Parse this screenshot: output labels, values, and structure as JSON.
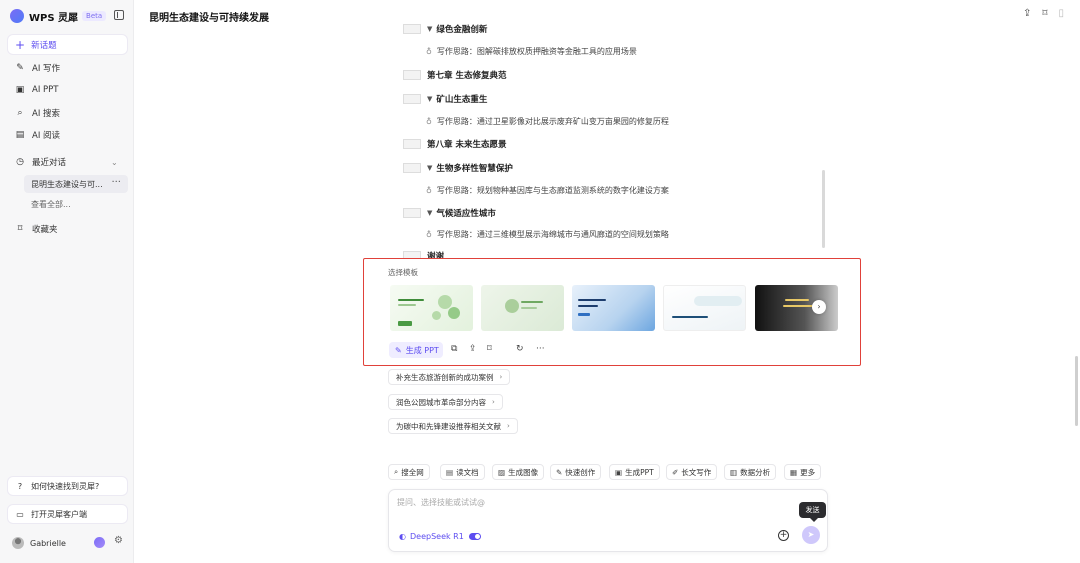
{
  "sidebar": {
    "brand": "WPS 灵犀",
    "beta": "Beta",
    "new_topic": "新话题",
    "nav": [
      {
        "icon": "✎",
        "label": "AI 写作"
      },
      {
        "icon": "▣",
        "label": "AI PPT"
      },
      {
        "icon": "⌕",
        "label": "AI 搜索"
      },
      {
        "icon": "▤",
        "label": "AI 阅读"
      }
    ],
    "recent_label": "最近对话",
    "recent_item": "昆明生态建设与可...",
    "see_all": "查看全部...",
    "favorites": "收藏夹",
    "help": "如何快速找到灵犀?",
    "open_client": "打开灵犀客户端",
    "user_name": "Gabrielle"
  },
  "header": {
    "title": "昆明生态建设与可持续发展"
  },
  "outline": [
    {
      "type": "section",
      "text": "绿色金融创新"
    },
    {
      "type": "idea",
      "text": "写作思路：图解碳排放权质押融资等金融工具的应用场景"
    },
    {
      "type": "chapter",
      "text": "第七章 生态修复典范"
    },
    {
      "type": "section",
      "text": "矿山生态重生"
    },
    {
      "type": "idea",
      "text": "写作思路：通过卫星影像对比展示废弃矿山变万亩果园的修复历程"
    },
    {
      "type": "chapter",
      "text": "第八章 未来生态愿景"
    },
    {
      "type": "section",
      "text": "生物多样性智慧保护"
    },
    {
      "type": "idea",
      "text": "写作思路：规划物种基因库与生态廊道监测系统的数字化建设方案"
    },
    {
      "type": "section",
      "text": "气候适应性城市"
    },
    {
      "type": "idea",
      "text": "写作思路：通过三维模型展示海绵城市与通风廊道的空间规划策略"
    },
    {
      "type": "chapter",
      "text": "谢谢"
    }
  ],
  "templates": {
    "label": "选择模板",
    "generate_ppt": "生成 PPT"
  },
  "suggestions": [
    "补充生态旅游创新的成功案例",
    "润色公园城市革命部分内容",
    "为碳中和先锋建设推荐相关文献"
  ],
  "tools": [
    {
      "icon": "⌕",
      "label": "搜全网"
    },
    {
      "icon": "▤",
      "label": "读文档"
    },
    {
      "icon": "▨",
      "label": "生成图像"
    },
    {
      "icon": "✎",
      "label": "快速创作"
    },
    {
      "icon": "▣",
      "label": "生成PPT"
    },
    {
      "icon": "✐",
      "label": "长文写作"
    },
    {
      "icon": "▥",
      "label": "数据分析"
    },
    {
      "icon": "▦",
      "label": "更多"
    }
  ],
  "input": {
    "placeholder": "提问、选择技能或试试@",
    "model": "DeepSeek R1",
    "send_tooltip": "发送"
  }
}
